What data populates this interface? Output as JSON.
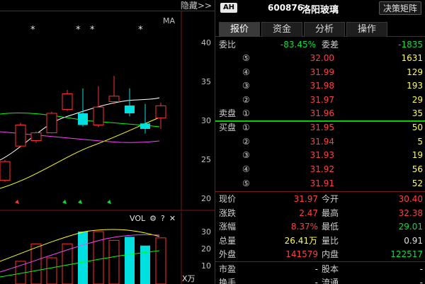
{
  "chart": {
    "hide_label": "隐藏>>",
    "ma_label": "MA",
    "price_axis": [
      "40",
      "35",
      "30",
      "25",
      "20"
    ],
    "volume_axis": [
      "30",
      "20",
      "10"
    ],
    "unit_label": "X万",
    "vol_header": {
      "label": "VOL",
      "settings_icon": "⚙",
      "help": "?",
      "close": "✕"
    },
    "colors": {
      "up": "#ff3030",
      "down": "#00e0e0",
      "ma5": "#ffffff",
      "ma10": "#ffff00",
      "ma20": "#ff40ff",
      "ma60": "#00ff00",
      "grid": "#7a1a1a"
    }
  },
  "chart_data": {
    "type": "candlestick",
    "ylim": [
      20,
      40
    ],
    "candles": [
      {
        "open": 22.4,
        "close": 24.8,
        "high": 25.0,
        "low": 22.2,
        "dir": "up"
      },
      {
        "open": 26.8,
        "close": 29.5,
        "high": 29.8,
        "low": 26.6,
        "dir": "up"
      },
      {
        "open": 27.5,
        "close": 28.5,
        "high": 28.7,
        "low": 27.2,
        "dir": "up"
      },
      {
        "open": 28.5,
        "close": 31.0,
        "high": 31.2,
        "low": 28.4,
        "dir": "up"
      },
      {
        "open": 31.5,
        "close": 33.5,
        "high": 34.0,
        "low": 31.3,
        "dir": "up"
      },
      {
        "open": 31.0,
        "close": 29.5,
        "high": 34.2,
        "low": 29.3,
        "dir": "down"
      },
      {
        "open": 29.5,
        "close": 31.8,
        "high": 34.5,
        "low": 29.2,
        "dir": "up"
      },
      {
        "open": 32.5,
        "close": 33.2,
        "high": 35.8,
        "low": 32.2,
        "dir": "up"
      },
      {
        "open": 32.0,
        "close": 31.0,
        "high": 34.2,
        "low": 30.6,
        "dir": "down"
      },
      {
        "open": 29.7,
        "close": 29.0,
        "high": 32.2,
        "low": 28.4,
        "dir": "down"
      },
      {
        "open": 30.4,
        "close": 31.97,
        "high": 32.38,
        "low": 29.01,
        "dir": "up"
      }
    ],
    "volumes": [
      {
        "value": 13,
        "dir": "up"
      },
      {
        "value": 23,
        "dir": "up"
      },
      {
        "value": 15,
        "dir": "up"
      },
      {
        "value": 23,
        "dir": "up"
      },
      {
        "value": 30,
        "dir": "down"
      },
      {
        "value": 30,
        "dir": "up"
      },
      {
        "value": 25,
        "dir": "up"
      },
      {
        "value": 27,
        "dir": "down"
      },
      {
        "value": 22,
        "dir": "down"
      },
      {
        "value": 26.41,
        "dir": "up"
      }
    ]
  },
  "header": {
    "badge": "AH",
    "code": "600876",
    "name": "洛阳玻璃",
    "matrix_button": "决策矩阵"
  },
  "tabs": [
    {
      "label": "报价",
      "active": true
    },
    {
      "label": "资金",
      "active": false
    },
    {
      "label": "分析",
      "active": false
    },
    {
      "label": "操作",
      "active": false
    }
  ],
  "order_book": {
    "weibi_label": "委比",
    "weibi_value": "-83.45%",
    "weicha_label": "委差",
    "weicha_value": "-1835",
    "sell_label": "卖盘",
    "buy_label": "买盘",
    "sells": [
      {
        "level": "⑤",
        "price": "32.00",
        "volume": "1631"
      },
      {
        "level": "④",
        "price": "31.99",
        "volume": "129"
      },
      {
        "level": "③",
        "price": "31.98",
        "volume": "193"
      },
      {
        "level": "②",
        "price": "31.97",
        "volume": "29"
      },
      {
        "level": "①",
        "price": "31.96",
        "volume": "35"
      }
    ],
    "buys": [
      {
        "level": "①",
        "price": "31.95",
        "volume": "50"
      },
      {
        "level": "②",
        "price": "31.94",
        "volume": "5"
      },
      {
        "level": "③",
        "price": "31.93",
        "volume": "19"
      },
      {
        "level": "④",
        "price": "31.92",
        "volume": "56"
      },
      {
        "level": "⑤",
        "price": "31.91",
        "volume": "52"
      }
    ]
  },
  "quote": {
    "price_label": "现价",
    "price": "31.97",
    "open_label": "今开",
    "open": "30.40",
    "change_label": "涨跌",
    "change": "2.47",
    "high_label": "最高",
    "high": "32.38",
    "pct_label": "涨幅",
    "pct": "8.37%",
    "low_label": "最低",
    "low": "29.01",
    "total_label": "总量",
    "total": "26.41",
    "total_unit": "万",
    "ratio_label": "量比",
    "ratio": "0.91",
    "outer_label": "外盘",
    "outer": "141579",
    "inner_label": "内盘",
    "inner": "122517",
    "mkt_label": "市盈",
    "mkt": "-",
    "share_label": "股本",
    "share": "-",
    "turn_label": "换手",
    "turn": "-",
    "float_label": "流通",
    "float": "-"
  }
}
